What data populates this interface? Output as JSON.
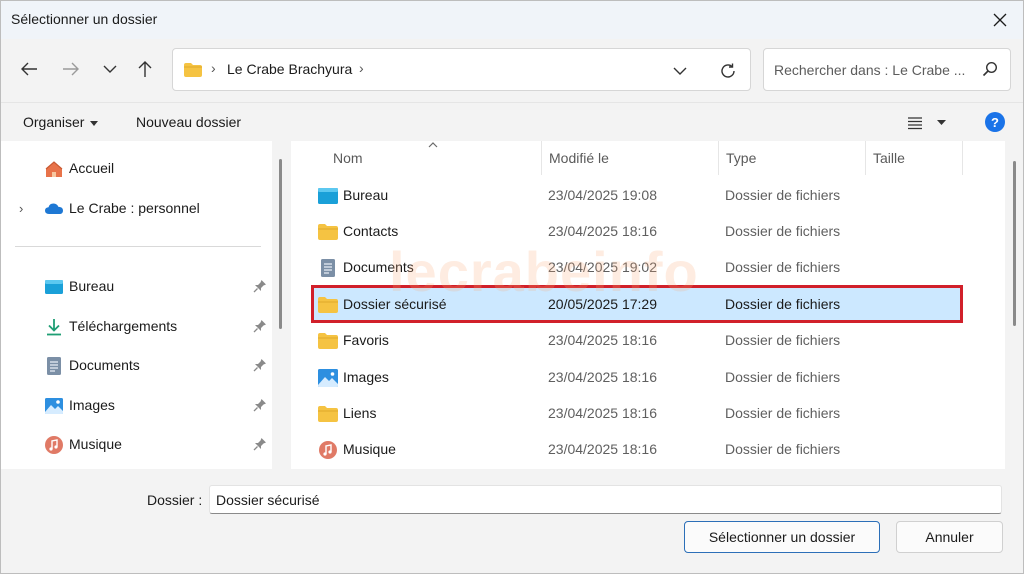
{
  "window": {
    "title": "Sélectionner un dossier"
  },
  "address": {
    "crumb": "Le Crabe Brachyura",
    "separator": "›"
  },
  "search": {
    "placeholder": "Rechercher dans : Le Crabe ..."
  },
  "commands": {
    "organize": "Organiser",
    "new_folder": "Nouveau dossier",
    "help": "?"
  },
  "nav": {
    "items": [
      {
        "label": "Accueil",
        "icon": "home-icon"
      },
      {
        "label": "Le Crabe : personnel",
        "icon": "onedrive-cloud-icon",
        "expander": "›"
      },
      {
        "label": "Bureau",
        "icon": "desktop-icon",
        "pinned": true
      },
      {
        "label": "Téléchargements",
        "icon": "download-icon",
        "pinned": true
      },
      {
        "label": "Documents",
        "icon": "document-icon",
        "pinned": true
      },
      {
        "label": "Images",
        "icon": "images-icon",
        "pinned": true
      },
      {
        "label": "Musique",
        "icon": "music-icon",
        "pinned": true
      }
    ]
  },
  "columns": {
    "name": "Nom",
    "modified": "Modifié le",
    "type": "Type",
    "size": "Taille"
  },
  "files": [
    {
      "name": "Bureau",
      "modified": "23/04/2025 19:08",
      "type": "Dossier de fichiers",
      "icon": "desktop-icon"
    },
    {
      "name": "Contacts",
      "modified": "23/04/2025 18:16",
      "type": "Dossier de fichiers",
      "icon": "folder-icon"
    },
    {
      "name": "Documents",
      "modified": "23/04/2025 19:02",
      "type": "Dossier de fichiers",
      "icon": "document-icon"
    },
    {
      "name": "Dossier sécurisé",
      "modified": "20/05/2025 17:29",
      "type": "Dossier de fichiers",
      "icon": "folder-icon",
      "selected": true
    },
    {
      "name": "Favoris",
      "modified": "23/04/2025 18:16",
      "type": "Dossier de fichiers",
      "icon": "folder-icon"
    },
    {
      "name": "Images",
      "modified": "23/04/2025 18:16",
      "type": "Dossier de fichiers",
      "icon": "images-icon"
    },
    {
      "name": "Liens",
      "modified": "23/04/2025 18:16",
      "type": "Dossier de fichiers",
      "icon": "folder-icon"
    },
    {
      "name": "Musique",
      "modified": "23/04/2025 18:16",
      "type": "Dossier de fichiers",
      "icon": "music-icon"
    }
  ],
  "watermark": "lecrabeinfo",
  "footer": {
    "folder_label": "Dossier :",
    "folder_value": "Dossier sécurisé",
    "select_button": "Sélectionner un dossier",
    "cancel_button": "Annuler"
  },
  "colors": {
    "accent": "#1a73e8",
    "selection": "#cce8ff",
    "highlight_border": "#d1202a",
    "folder": "#f5c342"
  }
}
